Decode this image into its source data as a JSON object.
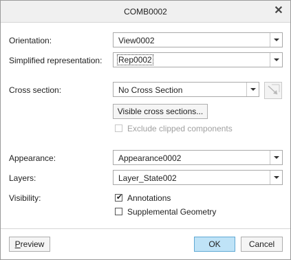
{
  "window": {
    "title": "COMB0002"
  },
  "fields": {
    "orientation": {
      "label": "Orientation:",
      "value": "View0002"
    },
    "simplified_rep": {
      "label": "Simplified representation:",
      "value": "Rep0002"
    },
    "cross_section": {
      "label": "Cross section:",
      "value": "No Cross Section"
    },
    "appearance": {
      "label": "Appearance:",
      "value": "Appearance0002"
    },
    "layers": {
      "label": "Layers:",
      "value": "Layer_State002"
    },
    "visibility": {
      "label": "Visibility:"
    }
  },
  "buttons": {
    "visible_cross_sections": "Visible cross sections...",
    "preview_first": "P",
    "preview_rest": "review",
    "ok": "OK",
    "cancel": "Cancel"
  },
  "checkboxes": {
    "exclude_clipped": {
      "label": "Exclude clipped components",
      "checked": false,
      "enabled": false
    },
    "annotations": {
      "label": "Annotations",
      "checked": true,
      "enabled": true
    },
    "supplemental_geometry": {
      "label": "Supplemental Geometry",
      "checked": false,
      "enabled": true
    }
  },
  "icons": {
    "close": "close-icon",
    "cross_section_flip": "cross-section-arrow-icon",
    "checkmark": "check-icon"
  },
  "colors": {
    "primary_button": "#bfe3f7",
    "primary_border": "#5fa8d3"
  }
}
